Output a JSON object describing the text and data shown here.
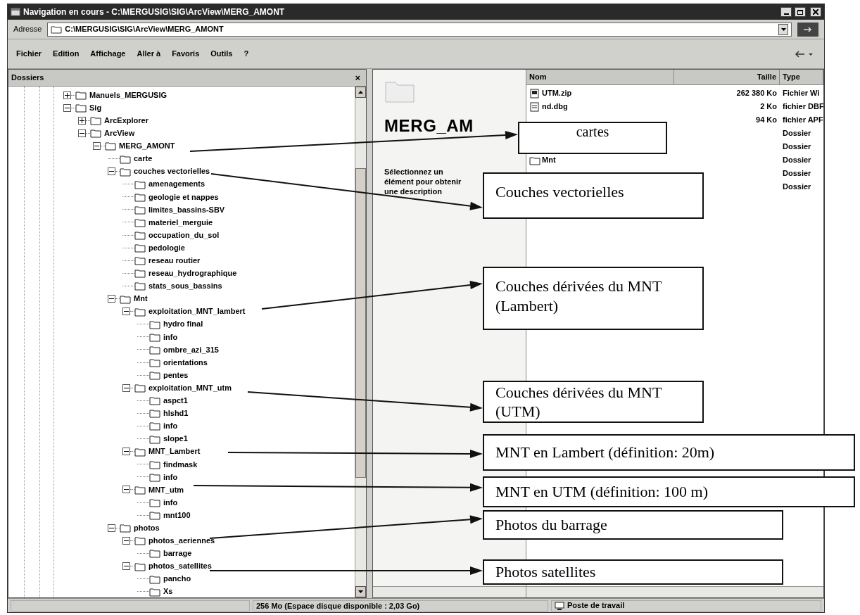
{
  "window": {
    "title": "Navigation en cours - C:\\MERGUSIG\\SIG\\ArcView\\MERG_AMONT"
  },
  "address_bar": {
    "label": "Adresse",
    "value": "C:\\MERGUSIG\\SIG\\ArcView\\MERG_AMONT"
  },
  "menu": [
    "Fichier",
    "Edition",
    "Affichage",
    "Aller à",
    "Favoris",
    "Outils",
    "?"
  ],
  "folders_pane": {
    "title": "Dossiers",
    "close": "×",
    "tree": [
      {
        "label": "Manuels_MERGUSIG",
        "expanded": false
      },
      {
        "label": "Sig",
        "expanded": true,
        "children": [
          {
            "label": "ArcExplorer",
            "expanded": false
          },
          {
            "label": "ArcView",
            "expanded": true,
            "children": [
              {
                "label": "MERG_AMONT",
                "expanded": true,
                "children": [
                  {
                    "label": "carte"
                  },
                  {
                    "label": "couches vectorielles",
                    "expanded": true,
                    "children": [
                      {
                        "label": "amenagements"
                      },
                      {
                        "label": "geologie et nappes"
                      },
                      {
                        "label": "limites_bassins-SBV"
                      },
                      {
                        "label": "materiel_merguie"
                      },
                      {
                        "label": "occupation_du_sol"
                      },
                      {
                        "label": "pedologie"
                      },
                      {
                        "label": "reseau routier"
                      },
                      {
                        "label": "reseau_hydrographique"
                      },
                      {
                        "label": "stats_sous_bassins"
                      }
                    ]
                  },
                  {
                    "label": "Mnt",
                    "expanded": true,
                    "children": [
                      {
                        "label": "exploitation_MNT_lambert",
                        "expanded": true,
                        "children": [
                          {
                            "label": "hydro final"
                          },
                          {
                            "label": "info"
                          },
                          {
                            "label": "ombre_azi_315"
                          },
                          {
                            "label": "orientations"
                          },
                          {
                            "label": "pentes"
                          }
                        ]
                      },
                      {
                        "label": "exploitation_MNT_utm",
                        "expanded": true,
                        "children": [
                          {
                            "label": "aspct1"
                          },
                          {
                            "label": "hlshd1"
                          },
                          {
                            "label": "info"
                          },
                          {
                            "label": "slope1"
                          }
                        ]
                      },
                      {
                        "label": "MNT_Lambert",
                        "expanded": true,
                        "children": [
                          {
                            "label": "findmask"
                          },
                          {
                            "label": "info"
                          }
                        ]
                      },
                      {
                        "label": "MNT_utm",
                        "expanded": true,
                        "children": [
                          {
                            "label": "info"
                          },
                          {
                            "label": "mnt100"
                          }
                        ]
                      }
                    ]
                  },
                  {
                    "label": "photos",
                    "expanded": true,
                    "children": [
                      {
                        "label": "photos_aeriennes",
                        "expanded": true,
                        "children": [
                          {
                            "label": "barrage"
                          }
                        ]
                      },
                      {
                        "label": "photos_satellites",
                        "expanded": true,
                        "children": [
                          {
                            "label": "pancho"
                          },
                          {
                            "label": "Xs"
                          }
                        ]
                      }
                    ]
                  }
                ]
              }
            ]
          }
        ]
      }
    ]
  },
  "details_panel": {
    "heading": "MERG_AM",
    "description": "Sélectionnez un élément pour obtenir une description"
  },
  "file_list": {
    "columns": [
      "Nom",
      "Taille",
      "Type"
    ],
    "rows": [
      {
        "kind": "zip",
        "name": "UTM.zip",
        "size": "262 380 Ko",
        "type": "Fichier Wi"
      },
      {
        "kind": "file",
        "name": "nd.dbg",
        "size": "2 Ko",
        "type": "fichier DBF"
      },
      {
        "size": "94 Ko",
        "type": "fichier APF"
      },
      {
        "type": "Dossier"
      },
      {
        "type": "Dossier"
      },
      {
        "kind": "folder",
        "name": "Mnt",
        "type": "Dossier"
      },
      {
        "type": "Dossier"
      },
      {
        "type": "Dossier"
      }
    ]
  },
  "status_bar": {
    "text": "256 Mo (Espace disque disponible : 2,03 Go)",
    "location": "Poste de travail"
  },
  "annotations": [
    {
      "text": "cartes"
    },
    {
      "text": "Couches vectorielles"
    },
    {
      "text": "Couches dérivées du MNT (Lambert)"
    },
    {
      "text": "Couches dérivées du MNT (UTM)"
    },
    {
      "text": "MNT en Lambert (définition: 20m)"
    },
    {
      "text": "MNT en UTM (définition:  100 m)"
    },
    {
      "text": "Photos du barrage"
    },
    {
      "text": "Photos satellites"
    }
  ]
}
